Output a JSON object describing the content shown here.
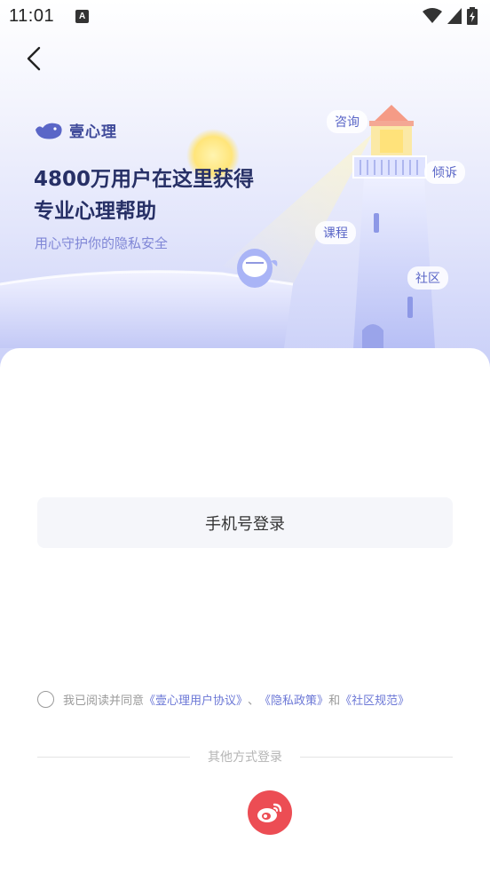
{
  "status_bar": {
    "time": "11:01",
    "notification_icon": "A"
  },
  "header": {
    "back_icon": "chevron-left-icon"
  },
  "hero": {
    "logo_text": "壹心理",
    "headline_line1": "4800万用户在这里获得",
    "headline_line2": "专业心理帮助",
    "subline": "用心守护你的隐私安全",
    "bubbles": [
      "咨询",
      "倾诉",
      "课程",
      "社区"
    ]
  },
  "login": {
    "phone_button": "手机号登录"
  },
  "agreement": {
    "prefix": "我已阅读并同意",
    "link_user": "《壹心理用户协议》",
    "sep1": "、",
    "link_privacy": "《隐私政策》",
    "sep2": "和",
    "link_community": "《社区规范》"
  },
  "other_login": {
    "label": "其他方式登录",
    "weibo_icon": "weibo-icon"
  },
  "colors": {
    "accent": "#6b77d6",
    "weibo": "#ec4d54",
    "headline": "#273066"
  }
}
